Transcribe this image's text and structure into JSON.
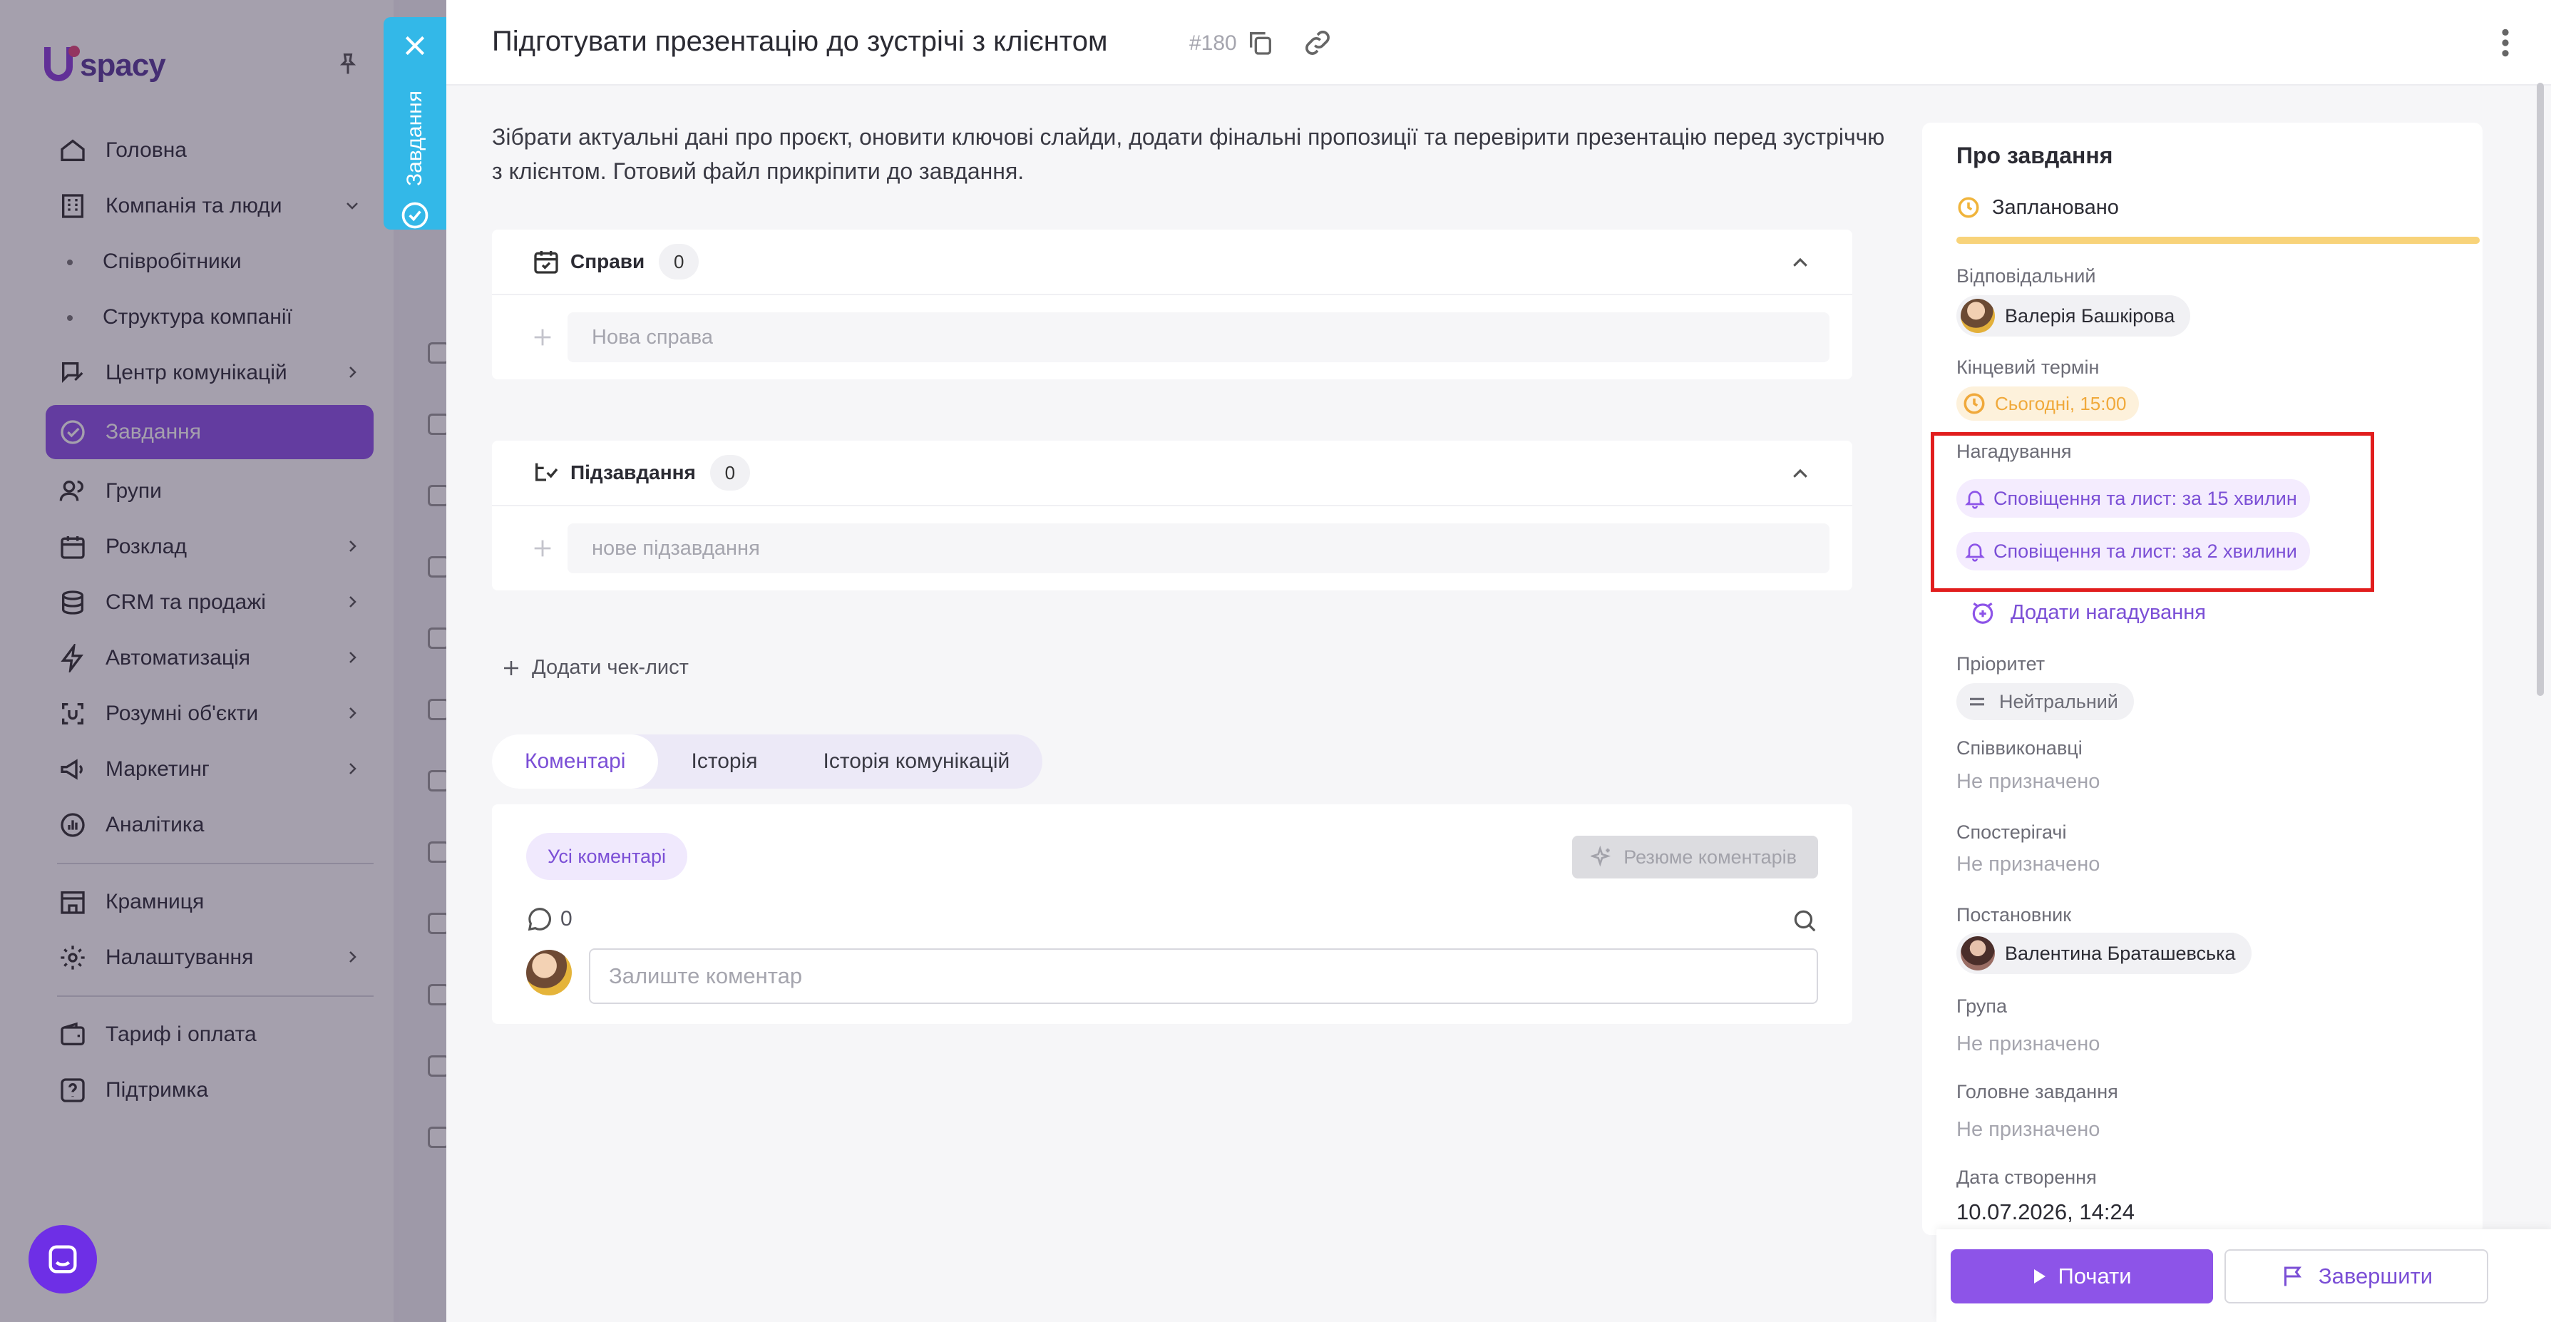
{
  "app": {
    "logo_text": "spacy"
  },
  "sidebar": {
    "items": [
      {
        "label": "Головна"
      },
      {
        "label": "Компанія та люди"
      },
      {
        "label": "Співробітники"
      },
      {
        "label": "Структура компанії"
      },
      {
        "label": "Центр комунікацій"
      },
      {
        "label": "Завдання"
      },
      {
        "label": "Групи"
      },
      {
        "label": "Розклад"
      },
      {
        "label": "CRM та продажі"
      },
      {
        "label": "Автоматизація"
      },
      {
        "label": "Розумні об'єкти"
      },
      {
        "label": "Маркетинг"
      },
      {
        "label": "Аналітика"
      },
      {
        "label": "Крамниця"
      },
      {
        "label": "Налаштування"
      },
      {
        "label": "Тариф і оплата"
      },
      {
        "label": "Підтримка"
      }
    ]
  },
  "task_tab": {
    "label": "Завдання"
  },
  "task": {
    "title": "Підготувати презентацію до зустрічі з клієнтом",
    "id": "#180",
    "description": "Зібрати актуальні дані про проєкт, оновити ключові слайди, додати фінальні пропозиції та перевірити презентацію перед зустріччю з клієнтом. Готовий файл прикріпити до завдання."
  },
  "todos": {
    "label": "Справи",
    "count": "0",
    "placeholder": "Нова справа"
  },
  "subtasks": {
    "label": "Підзавдання",
    "count": "0",
    "placeholder": "нове підзавдання"
  },
  "add_checklist": "Додати чек-лист",
  "tabs": [
    {
      "label": "Коментарі",
      "active": true
    },
    {
      "label": "Історія",
      "active": false
    },
    {
      "label": "Історія комунікацій",
      "active": false
    }
  ],
  "comments": {
    "filter_label": "Усі коментарі",
    "summary_label": "Резюме коментарів",
    "count": "0",
    "input_placeholder": "Залиште коментар"
  },
  "info": {
    "title": "Про завдання",
    "status": "Заплановано",
    "status_progress": 1.0,
    "assignee_label": "Відповідальний",
    "assignee": "Валерія Башкірова",
    "deadline_label": "Кінцевий термін",
    "deadline": "Сьогодні, 15:00",
    "reminders_label": "Нагадування",
    "reminders": [
      "Сповіщення та лист: за 15 хвилин",
      "Сповіщення та лист: за 2 хвилини"
    ],
    "add_reminder": "Додати нагадування",
    "priority_label": "Пріоритет",
    "priority": "Нейтральний",
    "coexecutors_label": "Співвиконавці",
    "coexecutors": "Не призначено",
    "observers_label": "Спостерігачі",
    "observers": "Не призначено",
    "creator_label": "Постановник",
    "creator": "Валентина Браташевська",
    "group_label": "Група",
    "group": "Не призначено",
    "parent_label": "Головне завдання",
    "parent": "Не призначено",
    "created_label": "Дата створення",
    "created": "10.07.2026, 14:24"
  },
  "footer": {
    "start_label": "Почати",
    "finish_label": "Завершити"
  },
  "colors": {
    "accent": "#8d54e8",
    "accent_text": "#7b4fd6",
    "tab_blue": "#33b8e8",
    "status_yellow": "#f8d37a",
    "highlight_red": "#e11d1d"
  }
}
